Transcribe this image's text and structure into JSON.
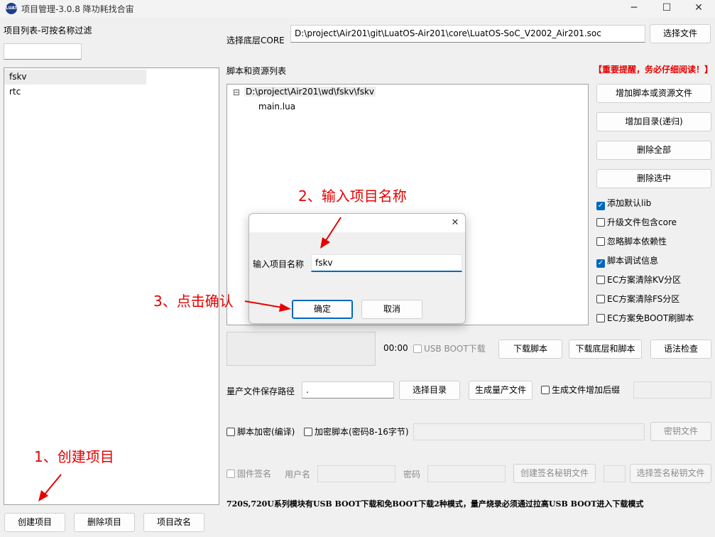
{
  "window": {
    "title": "项目管理-3.0.8 降功耗找合宙",
    "icon_text": "LUAT",
    "minimize_glyph": "─",
    "maximize_glyph": "☐",
    "close_glyph": "✕"
  },
  "left": {
    "filter_label": "项目列表-可按名称过滤",
    "filter_value": "",
    "projects": [
      "fskv",
      "rtc"
    ],
    "selected_index": 0,
    "create_btn": "创建项目",
    "delete_btn": "删除项目",
    "rename_btn": "项目改名"
  },
  "core": {
    "label": "选择底层CORE",
    "path": "D:\\project\\Air201\\git\\LuatOS-Air201\\core\\LuatOS-SoC_V2002_Air201.soc",
    "select_btn": "选择文件"
  },
  "scripts": {
    "label": "脚本和资源列表",
    "warning": "【重要提醒，务必仔细阅读！】",
    "tree_root": "D:\\project\\Air201\\wd\\fskv\\fskv",
    "tree_child": "main.lua",
    "expander": "⊟",
    "add_file_btn": "增加脚本或资源文件",
    "add_dir_btn": "增加目录(递归)",
    "delete_all_btn": "删除全部",
    "delete_sel_btn": "删除选中"
  },
  "options": [
    {
      "label": "添加默认lib",
      "checked": true
    },
    {
      "label": "升级文件包含core",
      "checked": false
    },
    {
      "label": "忽略脚本依赖性",
      "checked": false
    },
    {
      "label": "脚本调试信息",
      "checked": true
    },
    {
      "label": "EC方案清除KV分区",
      "checked": false
    },
    {
      "label": "EC方案清除FS分区",
      "checked": false
    },
    {
      "label": "EC方案免BOOT刷脚本",
      "checked": false
    }
  ],
  "download": {
    "timer": "00:00",
    "usb_boot_label": "USB BOOT下载",
    "download_script_btn": "下载脚本",
    "download_all_btn": "下载底层和脚本",
    "syntax_btn": "语法检查"
  },
  "production": {
    "label": "量产文件保存路径",
    "path_value": ".",
    "select_dir_btn": "选择目录",
    "gen_btn": "生成量产文件",
    "suffix_label": "生成文件增加后缀"
  },
  "encrypt": {
    "compile_label": "脚本加密(编译)",
    "password_label": "加密脚本(密码8-16字节)",
    "key_btn": "密钥文件"
  },
  "signing": {
    "firmware_sign_label": "固件签名",
    "username_label": "用户名",
    "password_label": "密码",
    "create_key_btn": "创建签名秘钥文件",
    "select_key_btn": "选择签名秘钥文件"
  },
  "footer_note": "720S,720U系列模块有USB BOOT下载和免BOOT下载2种模式，量产烧录必须通过拉高USB BOOT进入下载模式",
  "dialog": {
    "close_glyph": "✕",
    "label": "输入项目名称",
    "value": "fskv",
    "ok_btn": "确定",
    "cancel_btn": "取消"
  },
  "annotations": {
    "step1": "1、创建项目",
    "step2": "2、输入项目名称",
    "step3": "3、点击确认"
  },
  "colors": {
    "accent": "#0067c0",
    "annotation_red": "#e60000"
  }
}
